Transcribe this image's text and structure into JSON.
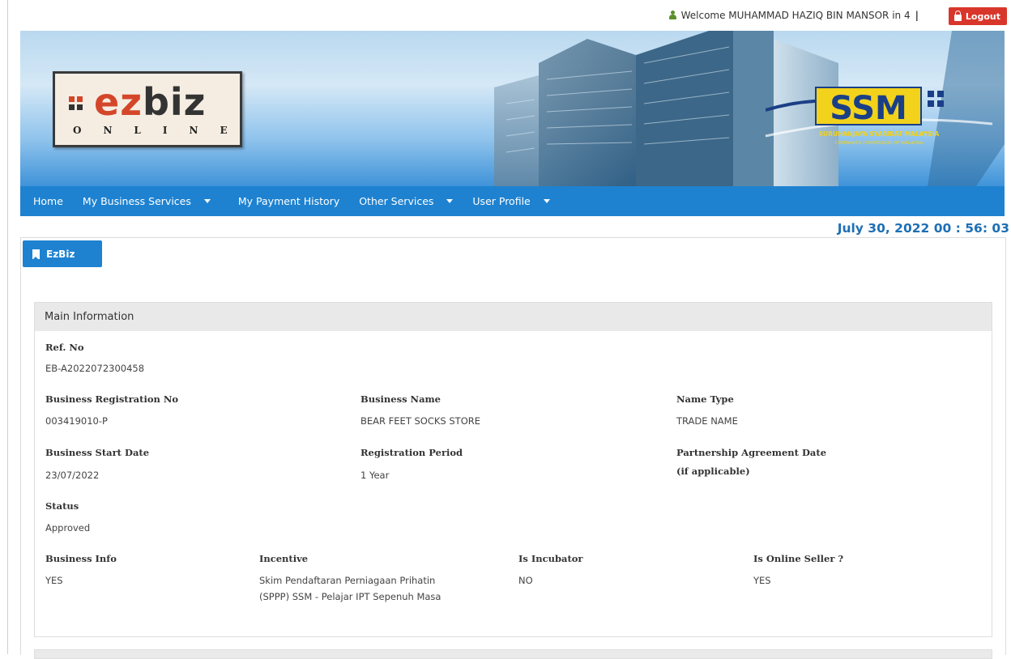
{
  "header": {
    "welcome_text": "Welcome MUHAMMAD HAZIQ BIN MANSOR in 4",
    "separator": "|",
    "logout_label": "Logout"
  },
  "banner": {
    "logo_main_ez": "ez",
    "logo_main_biz": "biz",
    "logo_sub": "ONLINE",
    "ssm_logo_text": "SSM",
    "ssm_name_line1": "SURUHANJAYA SYARIKAT MALAYSIA",
    "ssm_name_line2": "COMPANIES COMMISSION OF MALAYSIA"
  },
  "nav": {
    "items": [
      {
        "label": "Home",
        "dropdown": false
      },
      {
        "label": "My Business Services",
        "dropdown": true
      },
      {
        "label": "My Payment History",
        "dropdown": false
      },
      {
        "label": "Other Services",
        "dropdown": true
      },
      {
        "label": "User Profile",
        "dropdown": true
      }
    ]
  },
  "clock": "July 30, 2022 00 : 56: 03",
  "tab": {
    "label": "EzBiz"
  },
  "main_info": {
    "title": "Main Information",
    "ref_no_label": "Ref. No",
    "ref_no_value": "EB-A2022072300458",
    "brn_label": "Business Registration No",
    "brn_value": "003419010-P",
    "business_name_label": "Business Name",
    "business_name_value": "BEAR FEET SOCKS STORE",
    "name_type_label": "Name Type",
    "name_type_value": "TRADE NAME",
    "start_date_label": "Business Start Date",
    "start_date_value": "23/07/2022",
    "reg_period_label": "Registration Period",
    "reg_period_value": "1 Year",
    "partnership_label_line1": "Partnership Agreement Date",
    "partnership_label_line2": "(if applicable)",
    "status_label": "Status",
    "status_value": "Approved",
    "business_info_label": "Business Info",
    "business_info_value": "YES",
    "incentive_label": "Incentive",
    "incentive_value_line1": "Skim Pendaftaran Perniagaan Prihatin",
    "incentive_value_line2": "(SPPP) SSM - Pelajar IPT Sepenuh Masa",
    "incubator_label": "Is Incubator",
    "incubator_value": "NO",
    "online_seller_label": "Is Online Seller ?",
    "online_seller_value": "YES"
  },
  "colors": {
    "nav_blue": "#1e82d0",
    "logout_red": "#d9362b",
    "clock_blue": "#1e6fb5",
    "ssm_yellow": "#f2d21b"
  }
}
